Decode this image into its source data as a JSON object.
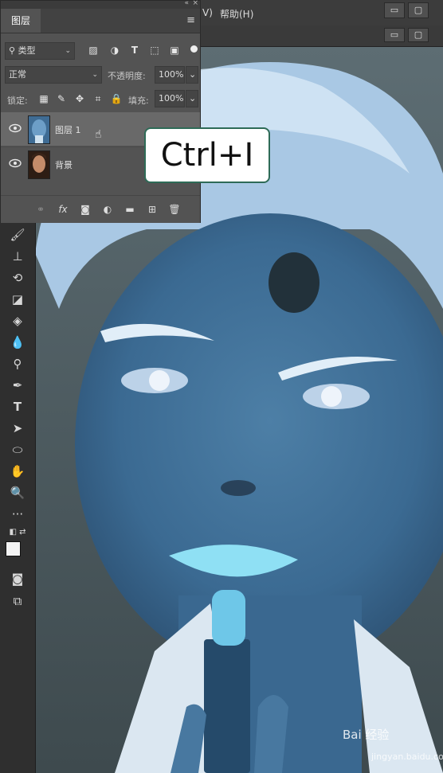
{
  "menubar": {
    "prev_item_tail": "V)",
    "help": "帮助(H)"
  },
  "layers_panel": {
    "tab": "图层",
    "filter_kind": "类型",
    "blend_mode": "正常",
    "opacity_label": "不透明度:",
    "opacity_value": "100%",
    "lock_label": "锁定:",
    "fill_label": "填充:",
    "fill_value": "100%",
    "layers": [
      {
        "name": "图层 1",
        "selected": true,
        "thumb": "inverted-portrait"
      },
      {
        "name": "背景",
        "selected": false,
        "thumb": "portrait"
      }
    ]
  },
  "shortcut": {
    "text": "Ctrl+I"
  },
  "watermark": {
    "text": "Bai 经验",
    "sub": "jingyan.baidu.com"
  },
  "colors": {
    "panel_bg": "#535353",
    "accent_border": "#2e6b57",
    "photo_tint": "#8fc0e0"
  },
  "icons": [
    "brush-icon",
    "stamp-icon",
    "history-brush-icon",
    "eraser-icon",
    "bucket-icon",
    "drop-icon",
    "dodge-icon",
    "pen-icon",
    "type-icon",
    "path-select-icon",
    "ellipse-icon",
    "hand-icon",
    "zoom-icon",
    "more-icon"
  ]
}
